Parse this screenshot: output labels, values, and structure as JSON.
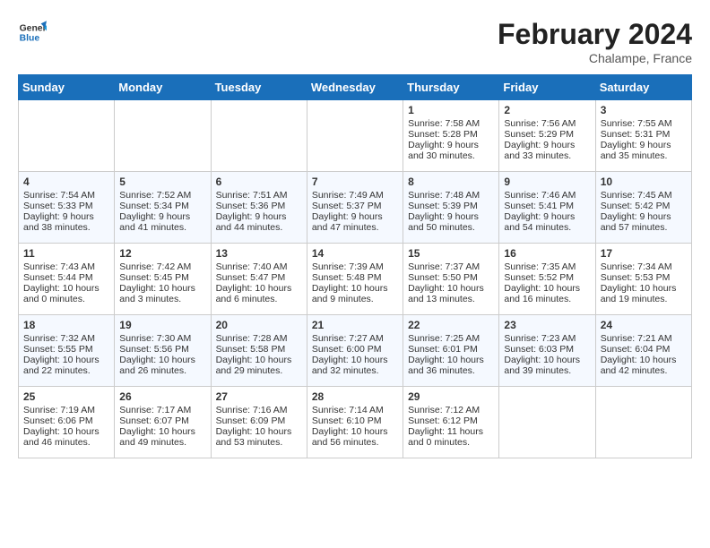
{
  "header": {
    "logo_line1": "General",
    "logo_line2": "Blue",
    "month": "February 2024",
    "location": "Chalampe, France"
  },
  "weekdays": [
    "Sunday",
    "Monday",
    "Tuesday",
    "Wednesday",
    "Thursday",
    "Friday",
    "Saturday"
  ],
  "weeks": [
    [
      {
        "day": "",
        "info": ""
      },
      {
        "day": "",
        "info": ""
      },
      {
        "day": "",
        "info": ""
      },
      {
        "day": "",
        "info": ""
      },
      {
        "day": "1",
        "info": "Sunrise: 7:58 AM\nSunset: 5:28 PM\nDaylight: 9 hours\nand 30 minutes."
      },
      {
        "day": "2",
        "info": "Sunrise: 7:56 AM\nSunset: 5:29 PM\nDaylight: 9 hours\nand 33 minutes."
      },
      {
        "day": "3",
        "info": "Sunrise: 7:55 AM\nSunset: 5:31 PM\nDaylight: 9 hours\nand 35 minutes."
      }
    ],
    [
      {
        "day": "4",
        "info": "Sunrise: 7:54 AM\nSunset: 5:33 PM\nDaylight: 9 hours\nand 38 minutes."
      },
      {
        "day": "5",
        "info": "Sunrise: 7:52 AM\nSunset: 5:34 PM\nDaylight: 9 hours\nand 41 minutes."
      },
      {
        "day": "6",
        "info": "Sunrise: 7:51 AM\nSunset: 5:36 PM\nDaylight: 9 hours\nand 44 minutes."
      },
      {
        "day": "7",
        "info": "Sunrise: 7:49 AM\nSunset: 5:37 PM\nDaylight: 9 hours\nand 47 minutes."
      },
      {
        "day": "8",
        "info": "Sunrise: 7:48 AM\nSunset: 5:39 PM\nDaylight: 9 hours\nand 50 minutes."
      },
      {
        "day": "9",
        "info": "Sunrise: 7:46 AM\nSunset: 5:41 PM\nDaylight: 9 hours\nand 54 minutes."
      },
      {
        "day": "10",
        "info": "Sunrise: 7:45 AM\nSunset: 5:42 PM\nDaylight: 9 hours\nand 57 minutes."
      }
    ],
    [
      {
        "day": "11",
        "info": "Sunrise: 7:43 AM\nSunset: 5:44 PM\nDaylight: 10 hours\nand 0 minutes."
      },
      {
        "day": "12",
        "info": "Sunrise: 7:42 AM\nSunset: 5:45 PM\nDaylight: 10 hours\nand 3 minutes."
      },
      {
        "day": "13",
        "info": "Sunrise: 7:40 AM\nSunset: 5:47 PM\nDaylight: 10 hours\nand 6 minutes."
      },
      {
        "day": "14",
        "info": "Sunrise: 7:39 AM\nSunset: 5:48 PM\nDaylight: 10 hours\nand 9 minutes."
      },
      {
        "day": "15",
        "info": "Sunrise: 7:37 AM\nSunset: 5:50 PM\nDaylight: 10 hours\nand 13 minutes."
      },
      {
        "day": "16",
        "info": "Sunrise: 7:35 AM\nSunset: 5:52 PM\nDaylight: 10 hours\nand 16 minutes."
      },
      {
        "day": "17",
        "info": "Sunrise: 7:34 AM\nSunset: 5:53 PM\nDaylight: 10 hours\nand 19 minutes."
      }
    ],
    [
      {
        "day": "18",
        "info": "Sunrise: 7:32 AM\nSunset: 5:55 PM\nDaylight: 10 hours\nand 22 minutes."
      },
      {
        "day": "19",
        "info": "Sunrise: 7:30 AM\nSunset: 5:56 PM\nDaylight: 10 hours\nand 26 minutes."
      },
      {
        "day": "20",
        "info": "Sunrise: 7:28 AM\nSunset: 5:58 PM\nDaylight: 10 hours\nand 29 minutes."
      },
      {
        "day": "21",
        "info": "Sunrise: 7:27 AM\nSunset: 6:00 PM\nDaylight: 10 hours\nand 32 minutes."
      },
      {
        "day": "22",
        "info": "Sunrise: 7:25 AM\nSunset: 6:01 PM\nDaylight: 10 hours\nand 36 minutes."
      },
      {
        "day": "23",
        "info": "Sunrise: 7:23 AM\nSunset: 6:03 PM\nDaylight: 10 hours\nand 39 minutes."
      },
      {
        "day": "24",
        "info": "Sunrise: 7:21 AM\nSunset: 6:04 PM\nDaylight: 10 hours\nand 42 minutes."
      }
    ],
    [
      {
        "day": "25",
        "info": "Sunrise: 7:19 AM\nSunset: 6:06 PM\nDaylight: 10 hours\nand 46 minutes."
      },
      {
        "day": "26",
        "info": "Sunrise: 7:17 AM\nSunset: 6:07 PM\nDaylight: 10 hours\nand 49 minutes."
      },
      {
        "day": "27",
        "info": "Sunrise: 7:16 AM\nSunset: 6:09 PM\nDaylight: 10 hours\nand 53 minutes."
      },
      {
        "day": "28",
        "info": "Sunrise: 7:14 AM\nSunset: 6:10 PM\nDaylight: 10 hours\nand 56 minutes."
      },
      {
        "day": "29",
        "info": "Sunrise: 7:12 AM\nSunset: 6:12 PM\nDaylight: 11 hours\nand 0 minutes."
      },
      {
        "day": "",
        "info": ""
      },
      {
        "day": "",
        "info": ""
      }
    ]
  ]
}
